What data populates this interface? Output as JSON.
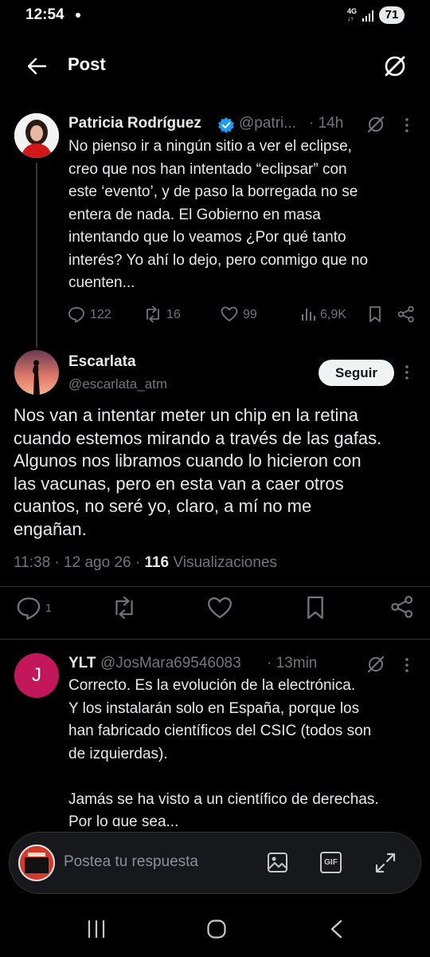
{
  "status": {
    "time": "12:54",
    "network": "4G",
    "battery": "71"
  },
  "header": {
    "title": "Post"
  },
  "parent_post": {
    "author": "Patricia Rodríguez",
    "handle": "@patri...",
    "time": "· 14h",
    "lines": [
      "No pienso ir a ningún sitio a ver el eclipse,",
      "creo que nos han intentado “eclipsar” con",
      "este ‘evento’, y de paso la borregada no se",
      "entera de nada. El Gobierno en masa",
      "intentando que lo veamos ¿Por qué tanto",
      "interés? Yo ahí lo dejo, pero conmigo que no",
      "cuenten..."
    ],
    "replies": "122",
    "reposts": "16",
    "likes": "99",
    "views": "6,9K"
  },
  "main_post": {
    "author": "Escarlata",
    "handle": "@escarlata_atm",
    "follow_label": "Seguir",
    "lines": [
      "Nos van a intentar meter un chip en la retina",
      "cuando estemos mirando a través de las gafas.",
      "Algunos nos libramos cuando lo hicieron con",
      "las vacunas, pero en esta van a caer otros",
      "cuantos, no seré yo, claro, a mí no me",
      "engañan."
    ],
    "time": "11:38",
    "date": "12 ago 26",
    "views_count": "116",
    "views_label": "Visualizaciones",
    "replies": "1"
  },
  "reply_post": {
    "avatar_letter": "J",
    "author": "YLT",
    "handle": "@JosMara69546083",
    "time": "· 13min",
    "lines": [
      "Correcto. Es la evolución de la electrónica.",
      "Y los instalarán solo en España, porque los",
      "han fabricado científicos del CSIC (todos son",
      "de izquierdas).",
      "",
      "Jamás se ha visto a un científico de derechas.",
      "Por lo que sea..."
    ]
  },
  "reply_bar": {
    "placeholder": "Postea tu respuesta",
    "gif_label": "GIF"
  },
  "colors": {
    "background": "#000000",
    "verified": "#1d9bf0",
    "reply_avatar": "#c2185b"
  }
}
